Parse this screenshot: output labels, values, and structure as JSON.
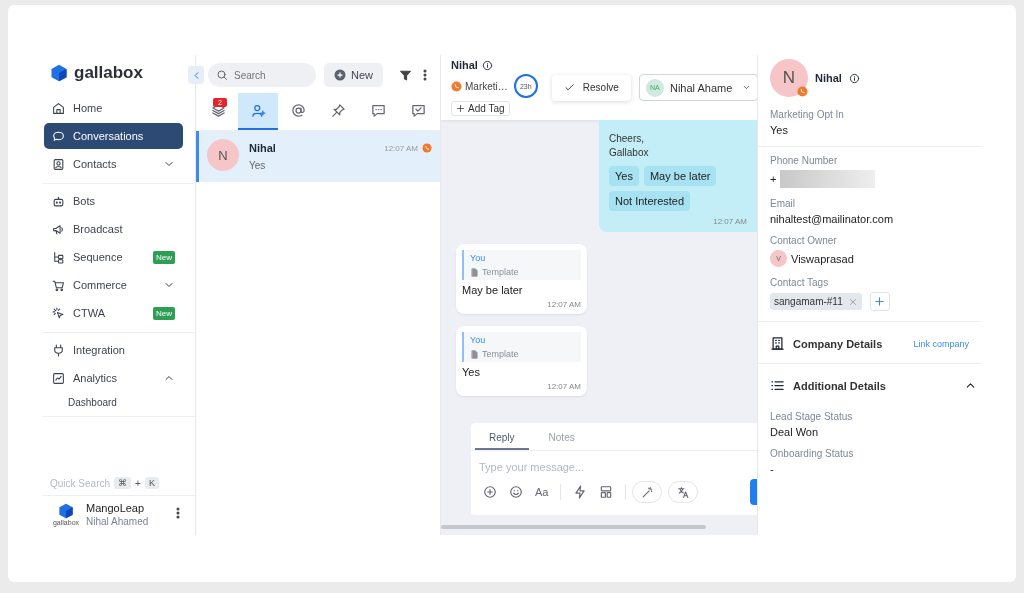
{
  "sidebar": {
    "logo": "gallabox",
    "sections": [
      {
        "items": [
          {
            "label": "Home",
            "selected": false
          },
          {
            "label": "Conversations",
            "selected": true
          },
          {
            "label": "Contacts",
            "selected": false,
            "expanded": false
          }
        ]
      },
      {
        "items": [
          {
            "label": "Bots",
            "selected": false
          },
          {
            "label": "Broadcast",
            "selected": false
          },
          {
            "label": "Sequence",
            "selected": false,
            "badge": "New"
          },
          {
            "label": "Commerce",
            "selected": false,
            "expanded": false
          },
          {
            "label": "CTWA",
            "selected": false,
            "badge": "New"
          }
        ]
      },
      {
        "items": [
          {
            "label": "Integration",
            "selected": false
          },
          {
            "label": "Analytics",
            "selected": false,
            "expanded": true,
            "children": [
              {
                "label": "Dashboard",
                "selected": false
              }
            ]
          }
        ]
      }
    ],
    "quick_search": {
      "label": "Quick Search",
      "keys": [
        "⌘",
        "K"
      ],
      "joiner": "+"
    },
    "account": {
      "logo_caption": "gallabox",
      "name": "MangoLeap",
      "user": "Nihal Ahamed"
    }
  },
  "conversation_list": {
    "search": {
      "placeholder": "Search"
    },
    "new_button": "New",
    "filter_tabs": [
      {
        "selected": false,
        "badge": "2"
      },
      {
        "selected": true
      },
      {
        "selected": false
      },
      {
        "selected": false
      },
      {
        "selected": false
      },
      {
        "selected": false
      }
    ],
    "conversations": [
      {
        "initial": "N",
        "name": "Nihal",
        "time": "12:07 AM",
        "preview": "Yes",
        "selected": true
      }
    ]
  },
  "chat": {
    "header": {
      "name": "Nihal",
      "channel": "Marketi…",
      "timer": "23h",
      "resolve": "Resolve",
      "assignee_initials": "NA",
      "assignee": "Nihal Ahame",
      "add_tag": "Add Tag"
    },
    "messages": [
      {
        "kind": "outgoing",
        "lines": [
          "Cheers,",
          "Gallabox"
        ],
        "buttons": [
          "Yes",
          "May be later",
          "Not Interested"
        ],
        "time": "12:07 AM"
      },
      {
        "kind": "incoming",
        "quote_author": "You",
        "quote_label": "Template",
        "text": "May be later",
        "time": "12:07 AM"
      },
      {
        "kind": "incoming",
        "quote_author": "You",
        "quote_label": "Template",
        "text": "Yes",
        "time": "12:07 AM"
      }
    ],
    "composer": {
      "tabs": [
        {
          "label": "Reply",
          "selected": true
        },
        {
          "label": "Notes",
          "selected": false
        }
      ],
      "placeholder": "Type your message...",
      "format_label": "Aa"
    }
  },
  "contact": {
    "initial": "N",
    "name": "Nihal",
    "opt_in": {
      "label": "Marketing Opt In",
      "value": "Yes"
    },
    "phone": {
      "label": "Phone Number",
      "value": "+"
    },
    "email": {
      "label": "Email",
      "value": "nihaltest@mailinator.com"
    },
    "owner": {
      "label": "Contact Owner",
      "initial": "V",
      "value": "Viswaprasad"
    },
    "tags": {
      "label": "Contact Tags",
      "items": [
        "sangamam-#11"
      ]
    },
    "company": {
      "title": "Company Details",
      "link": "Link company"
    },
    "additional": {
      "title": "Additional Details",
      "expanded": true,
      "fields": [
        {
          "label": "Lead Stage Status",
          "value": "Deal Won"
        },
        {
          "label": "Onboarding Status",
          "value": "-"
        }
      ]
    }
  }
}
